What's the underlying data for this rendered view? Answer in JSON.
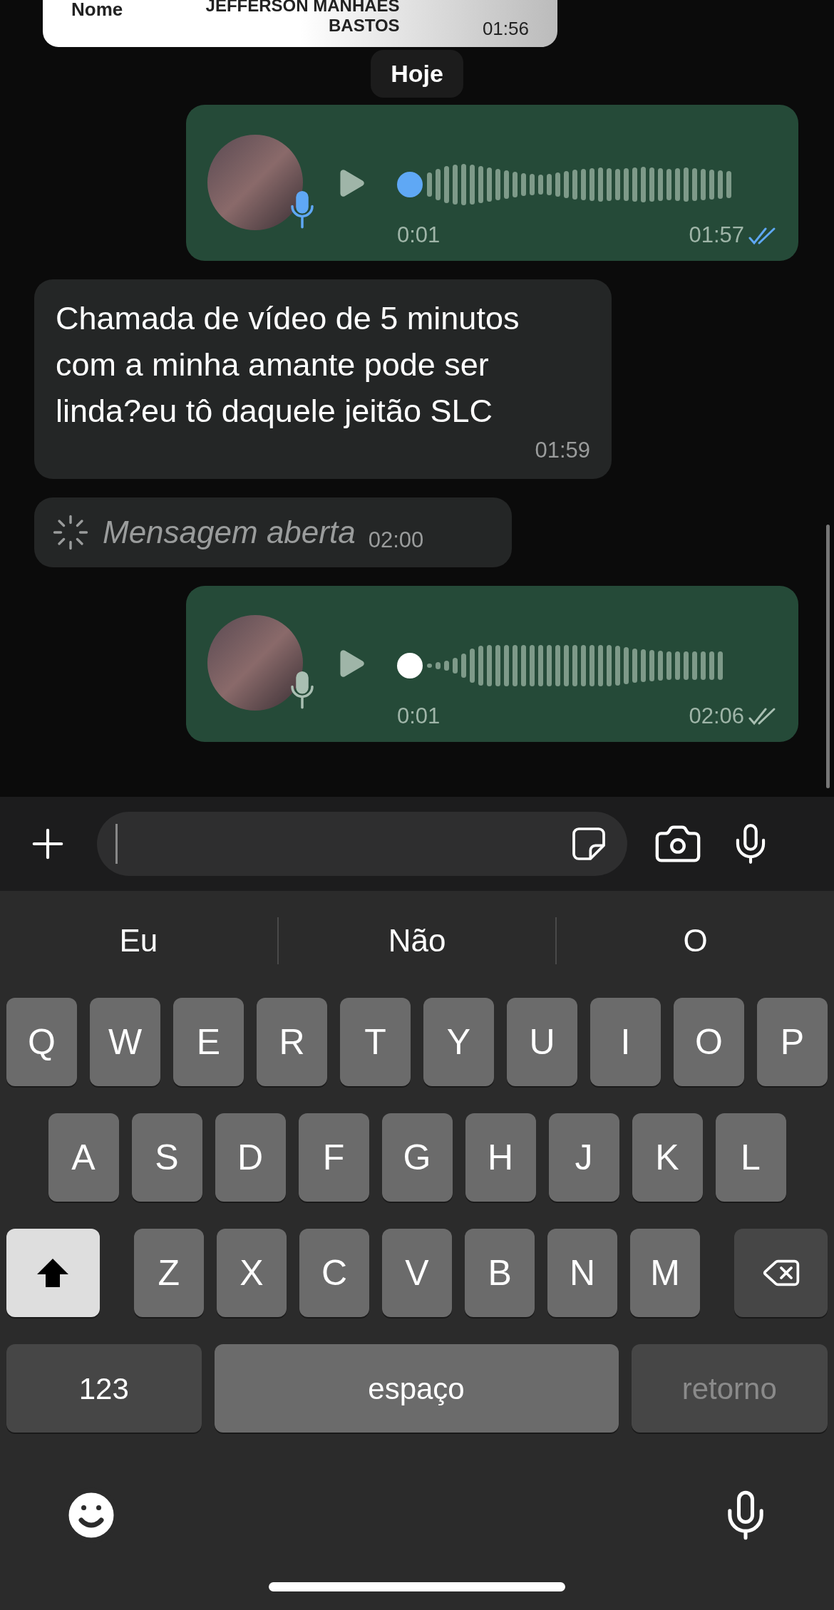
{
  "pinned_card": {
    "label": "Nome",
    "value_lines": [
      "JEFFERSON MANHAES",
      "BASTOS"
    ],
    "time": "01:56"
  },
  "date_chip": "Hoje",
  "messages": [
    {
      "kind": "voice",
      "duration": "0:01",
      "time": "01:57",
      "listened": true,
      "read": true
    },
    {
      "kind": "text",
      "text": "Chamada de vídeo de 5 minutos com a minha amante pode ser linda?eu tô daquele jeitão SLC",
      "time": "01:59"
    },
    {
      "kind": "view_once",
      "text": "Mensagem aberta",
      "time": "02:00"
    },
    {
      "kind": "voice",
      "duration": "0:01",
      "time": "02:06",
      "listened": false,
      "read": false
    }
  ],
  "keyboard": {
    "suggestions": [
      "Eu",
      "Não",
      "O"
    ],
    "rows": [
      [
        {
          "kind": "letter",
          "label": "Q"
        },
        {
          "kind": "letter",
          "label": "W"
        },
        {
          "kind": "letter",
          "label": "E"
        },
        {
          "kind": "letter",
          "label": "R"
        },
        {
          "kind": "letter",
          "label": "T"
        },
        {
          "kind": "letter",
          "label": "Y"
        },
        {
          "kind": "letter",
          "label": "U"
        },
        {
          "kind": "letter",
          "label": "I"
        },
        {
          "kind": "letter",
          "label": "O"
        },
        {
          "kind": "letter",
          "label": "P"
        }
      ],
      [
        {
          "kind": "letter",
          "label": "A"
        },
        {
          "kind": "letter",
          "label": "S"
        },
        {
          "kind": "letter",
          "label": "D"
        },
        {
          "kind": "letter",
          "label": "F"
        },
        {
          "kind": "letter",
          "label": "G"
        },
        {
          "kind": "letter",
          "label": "H"
        },
        {
          "kind": "letter",
          "label": "J"
        },
        {
          "kind": "letter",
          "label": "K"
        },
        {
          "kind": "letter",
          "label": "L"
        }
      ],
      [
        {
          "kind": "shift",
          "on": true
        },
        {
          "kind": "letter",
          "label": "Z"
        },
        {
          "kind": "letter",
          "label": "X"
        },
        {
          "kind": "letter",
          "label": "C"
        },
        {
          "kind": "letter",
          "label": "V"
        },
        {
          "kind": "letter",
          "label": "B"
        },
        {
          "kind": "letter",
          "label": "N"
        },
        {
          "kind": "letter",
          "label": "M"
        },
        {
          "kind": "backspace"
        }
      ]
    ],
    "bottom_row": {
      "numbers": "123",
      "space": "espaço",
      "return": {
        "label": "retorno",
        "disabled": true
      }
    }
  }
}
